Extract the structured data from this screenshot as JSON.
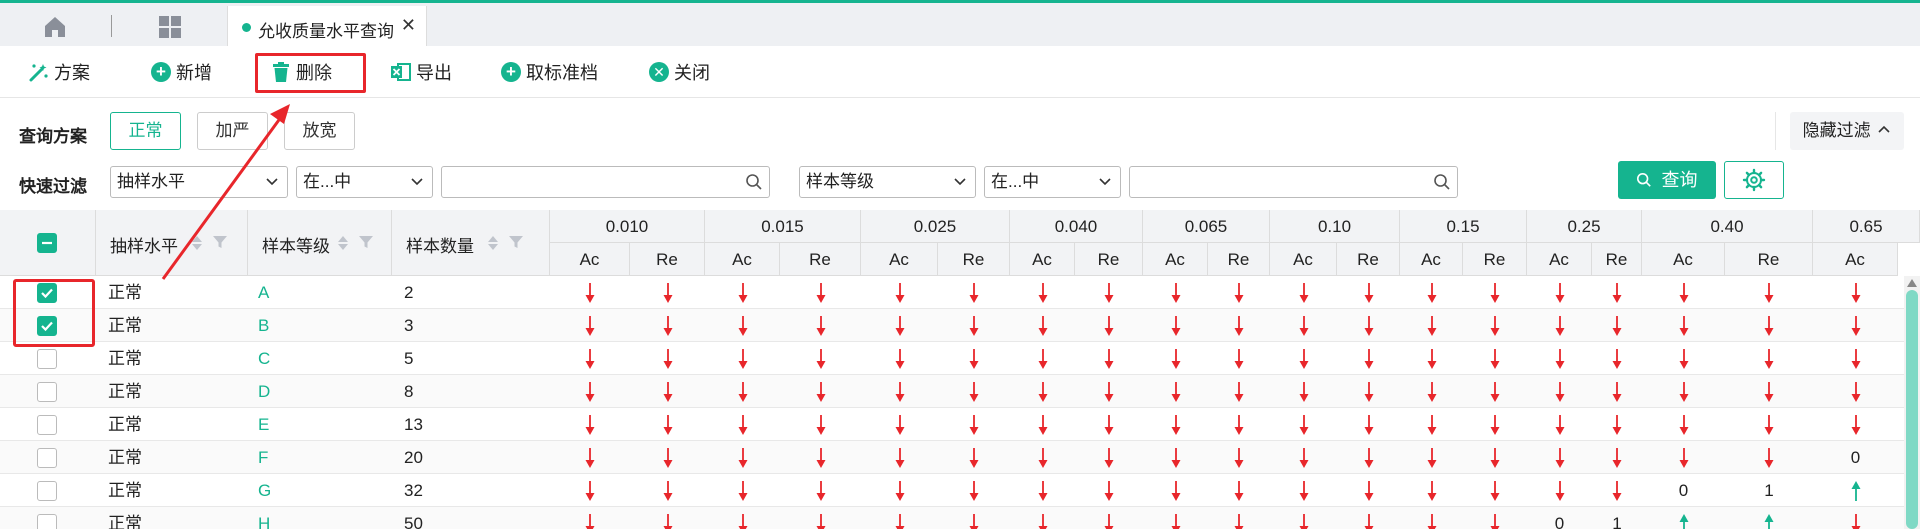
{
  "tabbar": {
    "active_tab_title": "允收质量水平查询",
    "close_glyph": "✕",
    "home_icon": "home-icon",
    "apps_icon": "apps-grid-icon"
  },
  "toolbar": {
    "scheme": "方案",
    "add": "新增",
    "delete": "删除",
    "export": "导出",
    "cancel_standard": "取标准档",
    "close": "关闭"
  },
  "filters": {
    "scheme_label": "查询方案",
    "schemes": [
      "正常",
      "加严",
      "放宽"
    ],
    "active_scheme": "正常",
    "hide_filter": "隐藏过滤",
    "quick_label": "快速过滤",
    "field1": "抽样水平",
    "op1": "在...中",
    "value1": "",
    "field2": "样本等级",
    "op2": "在...中",
    "value2": "",
    "query": "查询"
  },
  "table": {
    "columns": {
      "level": "抽样水平",
      "grade": "样本等级",
      "size": "样本数量"
    },
    "aql": [
      "0.010",
      "0.015",
      "0.025",
      "0.040",
      "0.065",
      "0.10",
      "0.15",
      "0.25",
      "0.40",
      "0.65"
    ],
    "ac": "Ac",
    "re": "Re",
    "rows": [
      {
        "checked": true,
        "level": "正常",
        "grade": "A",
        "size": "2",
        "cells": [
          "d",
          "d",
          "d",
          "d",
          "d",
          "d",
          "d",
          "d",
          "d",
          "d",
          "d",
          "d",
          "d",
          "d",
          "d",
          "d",
          "d",
          "d",
          "d"
        ]
      },
      {
        "checked": true,
        "level": "正常",
        "grade": "B",
        "size": "3",
        "cells": [
          "d",
          "d",
          "d",
          "d",
          "d",
          "d",
          "d",
          "d",
          "d",
          "d",
          "d",
          "d",
          "d",
          "d",
          "d",
          "d",
          "d",
          "d",
          "d"
        ]
      },
      {
        "checked": false,
        "level": "正常",
        "grade": "C",
        "size": "5",
        "cells": [
          "d",
          "d",
          "d",
          "d",
          "d",
          "d",
          "d",
          "d",
          "d",
          "d",
          "d",
          "d",
          "d",
          "d",
          "d",
          "d",
          "d",
          "d",
          "d"
        ]
      },
      {
        "checked": false,
        "level": "正常",
        "grade": "D",
        "size": "8",
        "cells": [
          "d",
          "d",
          "d",
          "d",
          "d",
          "d",
          "d",
          "d",
          "d",
          "d",
          "d",
          "d",
          "d",
          "d",
          "d",
          "d",
          "d",
          "d",
          "d"
        ]
      },
      {
        "checked": false,
        "level": "正常",
        "grade": "E",
        "size": "13",
        "cells": [
          "d",
          "d",
          "d",
          "d",
          "d",
          "d",
          "d",
          "d",
          "d",
          "d",
          "d",
          "d",
          "d",
          "d",
          "d",
          "d",
          "d",
          "d",
          "d"
        ]
      },
      {
        "checked": false,
        "level": "正常",
        "grade": "F",
        "size": "20",
        "cells": [
          "d",
          "d",
          "d",
          "d",
          "d",
          "d",
          "d",
          "d",
          "d",
          "d",
          "d",
          "d",
          "d",
          "d",
          "d",
          "d",
          "d",
          "d",
          "0"
        ]
      },
      {
        "checked": false,
        "level": "正常",
        "grade": "G",
        "size": "32",
        "cells": [
          "d",
          "d",
          "d",
          "d",
          "d",
          "d",
          "d",
          "d",
          "d",
          "d",
          "d",
          "d",
          "d",
          "d",
          "d",
          "d",
          "0",
          "1",
          "u"
        ]
      },
      {
        "checked": false,
        "level": "正常",
        "grade": "H",
        "size": "50",
        "cells": [
          "d",
          "d",
          "d",
          "d",
          "d",
          "d",
          "d",
          "d",
          "d",
          "d",
          "d",
          "d",
          "d",
          "d",
          "0",
          "1",
          "u",
          "u",
          "d"
        ]
      }
    ]
  },
  "colors": {
    "accent": "#15b48f",
    "arrow_red": "#e8262b",
    "annotation_red": "#e8262b",
    "grade_link": "#15b48f"
  }
}
